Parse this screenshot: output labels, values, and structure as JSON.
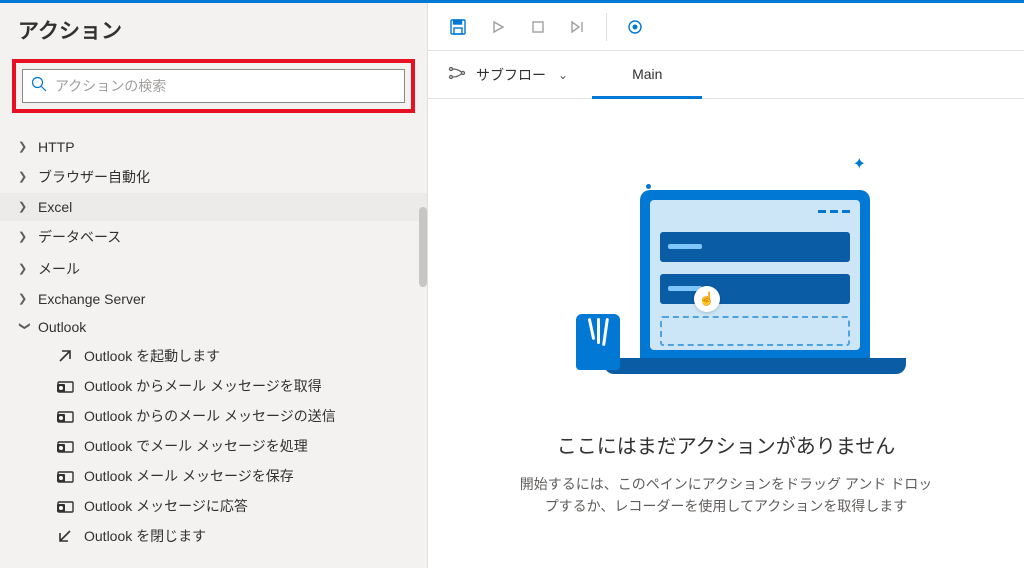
{
  "sidebar": {
    "title": "アクション",
    "search_placeholder": "アクションの検索",
    "categories": [
      {
        "label": "HTTP",
        "expanded": false
      },
      {
        "label": "ブラウザー自動化",
        "expanded": false
      },
      {
        "label": "Excel",
        "expanded": false,
        "highlighted": true
      },
      {
        "label": "データベース",
        "expanded": false
      },
      {
        "label": "メール",
        "expanded": false
      },
      {
        "label": "Exchange Server",
        "expanded": false
      },
      {
        "label": "Outlook",
        "expanded": true
      }
    ],
    "outlook_actions": [
      {
        "icon": "arrow-up-right",
        "label": "Outlook を起動します"
      },
      {
        "icon": "mail-gear",
        "label": "Outlook からメール メッセージを取得"
      },
      {
        "icon": "mail-gear",
        "label": "Outlook からのメール メッセージの送信"
      },
      {
        "icon": "mail-gear",
        "label": "Outlook でメール メッセージを処理"
      },
      {
        "icon": "mail-gear",
        "label": "Outlook メール メッセージを保存"
      },
      {
        "icon": "mail-gear",
        "label": "Outlook メッセージに応答"
      },
      {
        "icon": "arrow-down-left",
        "label": "Outlook を閉じます"
      }
    ]
  },
  "tabbar": {
    "subflow_label": "サブフロー",
    "tab_main": "Main"
  },
  "canvas": {
    "empty_title": "ここにはまだアクションがありません",
    "empty_sub": "開始するには、このペインにアクションをドラッグ アンド ドロップするか、レコーダーを使用してアクションを取得します"
  }
}
